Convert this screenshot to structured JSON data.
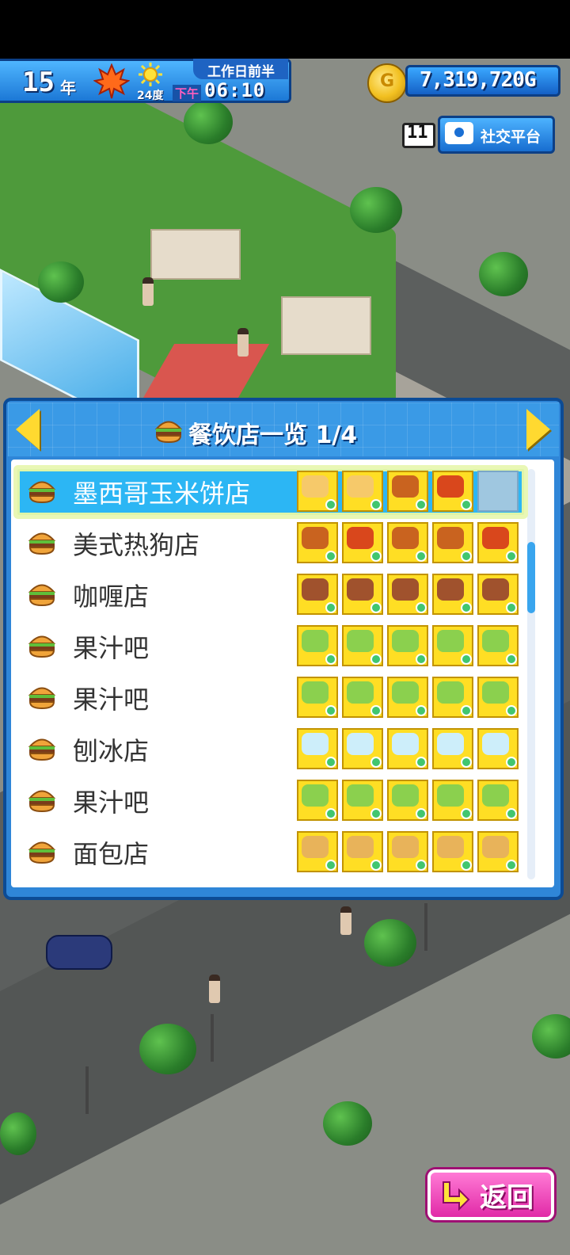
{
  "hud": {
    "year": "15",
    "year_unit": "年",
    "temperature": "24度",
    "ampm": "下午",
    "time": "06:10",
    "workday": "工作日前半",
    "money": "7,319,720G",
    "notification_count": "11",
    "social_label": "社交平台"
  },
  "panel": {
    "title": "餐饮店一览 1/4"
  },
  "shops": [
    {
      "name": "墨西哥玉米饼店",
      "selected": true,
      "items": [
        "taco",
        "taco",
        "drumstick",
        "corndog",
        "empty"
      ]
    },
    {
      "name": "美式热狗店",
      "selected": false,
      "items": [
        "drumstick",
        "corndog",
        "drumstick",
        "drumstick",
        "corndog"
      ]
    },
    {
      "name": "咖喱店",
      "selected": false,
      "items": [
        "curry",
        "curry",
        "curry",
        "curry",
        "curry"
      ]
    },
    {
      "name": "果汁吧",
      "selected": false,
      "items": [
        "juice",
        "juice",
        "juice",
        "juice",
        "juice"
      ]
    },
    {
      "name": "果汁吧",
      "selected": false,
      "items": [
        "juice",
        "juice",
        "juice",
        "juice",
        "juice"
      ]
    },
    {
      "name": "刨冰店",
      "selected": false,
      "items": [
        "shaved-ice",
        "shaved-ice",
        "shaved-ice",
        "shaved-ice",
        "shaved-ice"
      ]
    },
    {
      "name": "果汁吧",
      "selected": false,
      "items": [
        "juice",
        "juice",
        "juice",
        "juice",
        "juice"
      ]
    },
    {
      "name": "面包店",
      "selected": false,
      "items": [
        "bread",
        "bread",
        "bread",
        "bread",
        "bread"
      ]
    }
  ],
  "back_button": {
    "label": "返回"
  },
  "colors": {
    "hud_blue": "#1c78d6",
    "panel_blue": "#2f86d8",
    "selected_row": "#2cb6f4",
    "item_yellow": "#ffde24",
    "back_pink": "#e12aa7"
  }
}
